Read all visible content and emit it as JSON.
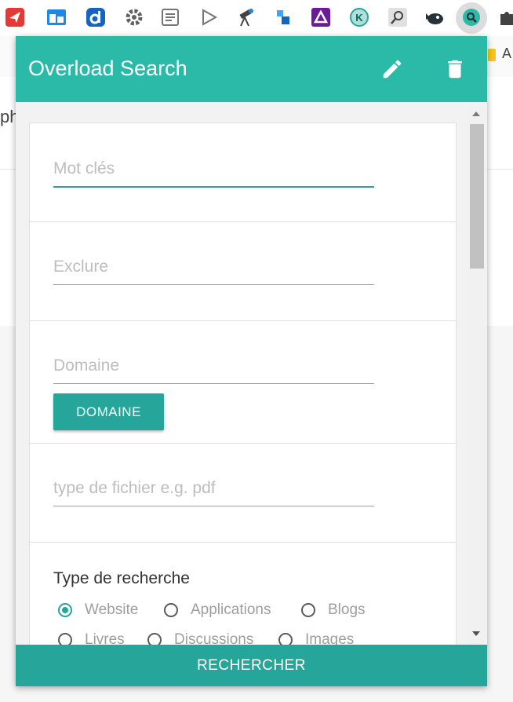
{
  "header": {
    "title": "Overload Search",
    "edit_icon": "pencil-icon",
    "delete_icon": "trash-icon"
  },
  "fields": {
    "keywords_placeholder": "Mot clés",
    "exclude_placeholder": "Exclure",
    "domain_placeholder": "Domaine",
    "filetype_placeholder": "type de fichier e.g. pdf"
  },
  "domain_button": "DOMAINE",
  "search_type": {
    "label": "Type de recherche",
    "options": [
      "Website",
      "Applications",
      "Blogs",
      "Livres",
      "Discussions",
      "Images"
    ],
    "selected": "Website"
  },
  "footer": {
    "search_button": "RECHERCHER"
  },
  "background": {
    "partial_text": "ph",
    "partial_letter": "A"
  },
  "colors": {
    "primary": "#2bb9a8",
    "button": "#26a69a"
  }
}
